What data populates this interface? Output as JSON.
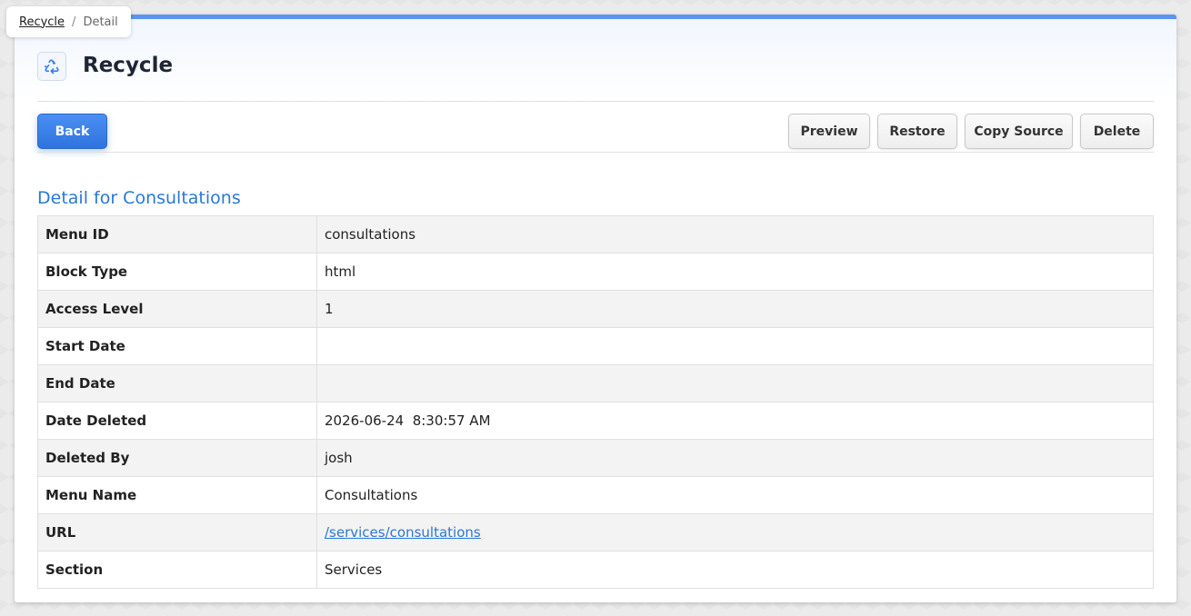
{
  "breadcrumb": {
    "link": "Recycle",
    "separator": "/",
    "current": "Detail"
  },
  "header": {
    "title": "Recycle",
    "icon": "recycle-icon"
  },
  "toolbar": {
    "back_label": "Back",
    "preview_label": "Preview",
    "restore_label": "Restore",
    "copy_source_label": "Copy Source",
    "delete_label": "Delete"
  },
  "detail": {
    "heading": "Detail for Consultations",
    "rows": [
      {
        "label": "Menu ID",
        "value": "consultations"
      },
      {
        "label": "Block Type",
        "value": "html"
      },
      {
        "label": "Access Level",
        "value": "1"
      },
      {
        "label": "Start Date",
        "value": ""
      },
      {
        "label": "End Date",
        "value": ""
      },
      {
        "label": "Date Deleted",
        "value": "2026-06-24  8:30:57 AM"
      },
      {
        "label": "Deleted By",
        "value": "josh"
      },
      {
        "label": "Menu Name",
        "value": "Consultations"
      },
      {
        "label": "URL",
        "value": "/services/consultations"
      },
      {
        "label": "Section",
        "value": "Services"
      }
    ]
  },
  "colors": {
    "accent": "#2a78d8",
    "primary_button": "#3a7fe8",
    "top_border": "#5b94ee"
  }
}
